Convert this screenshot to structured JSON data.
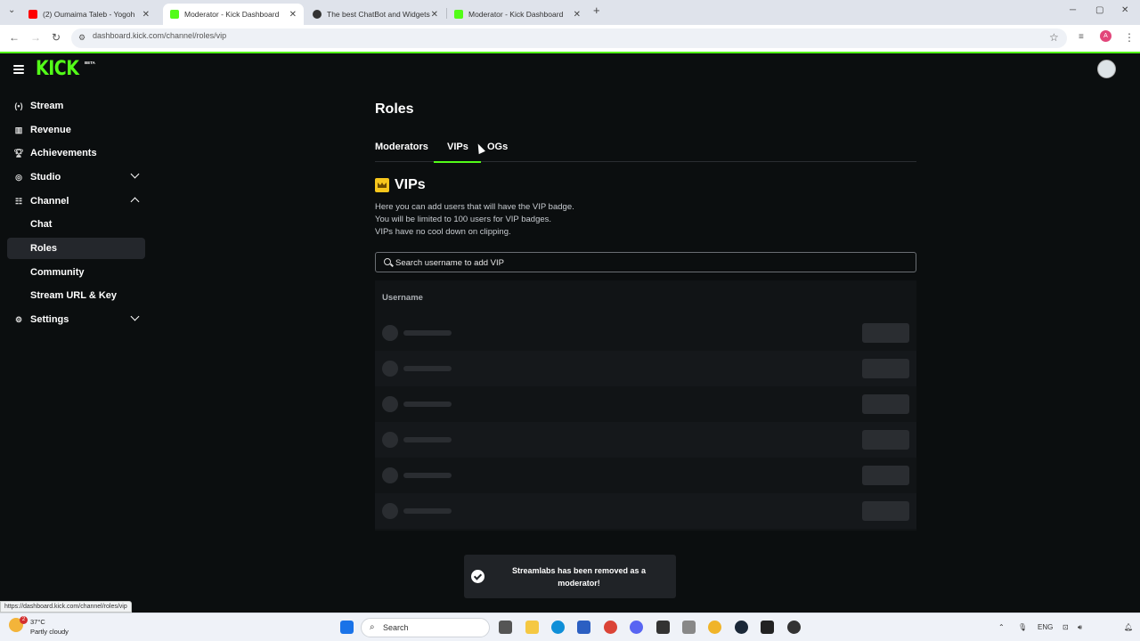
{
  "browser": {
    "tabs": [
      {
        "label": "(2) Oumaima Taleb - Yogoh",
        "favicon_color": "#ff0000",
        "active": false
      },
      {
        "label": "Moderator - Kick Dashboard",
        "favicon_color": "#53fc18",
        "active": true
      },
      {
        "label": "The best ChatBot and Widgets",
        "favicon_color": "#333333",
        "active": false
      },
      {
        "label": "Moderator - Kick Dashboard",
        "favicon_color": "#53fc18",
        "active": false
      }
    ],
    "url": "dashboard.kick.com/channel/roles/vip",
    "status_url": "https://dashboard.kick.com/channel/roles/vip",
    "profile_initial": "A"
  },
  "app": {
    "logo": "KICK",
    "logo_badge": "BETA",
    "accent_color": "#53fc18"
  },
  "sidebar": {
    "items": [
      {
        "label": "Stream",
        "icon": "broadcast-icon"
      },
      {
        "label": "Revenue",
        "icon": "bar-chart-icon"
      },
      {
        "label": "Achievements",
        "icon": "trophy-icon"
      },
      {
        "label": "Studio",
        "icon": "studio-icon"
      },
      {
        "label": "Channel",
        "icon": "channel-icon"
      },
      {
        "label": "Chat"
      },
      {
        "label": "Roles"
      },
      {
        "label": "Community"
      },
      {
        "label": "Stream URL & Key"
      },
      {
        "label": "Settings",
        "icon": "gear-icon"
      }
    ]
  },
  "main": {
    "title": "Roles",
    "tabs": [
      "Moderators",
      "VIPs",
      "OGs"
    ],
    "active_tab": "VIPs",
    "section_title": "VIPs",
    "description": [
      "Here you can add users that will have the VIP badge.",
      "You will be limited to 100 users for VIP badges.",
      "VIPs have no cool down on clipping."
    ],
    "search_placeholder": "Search username to add VIP",
    "table_header": "Username"
  },
  "toast": {
    "message": "Streamlabs has been removed as a moderator!"
  },
  "taskbar": {
    "temperature": "37°C",
    "condition": "Partly cloudy",
    "weather_badge": "2",
    "search_label": "Search",
    "language": "ENG"
  }
}
